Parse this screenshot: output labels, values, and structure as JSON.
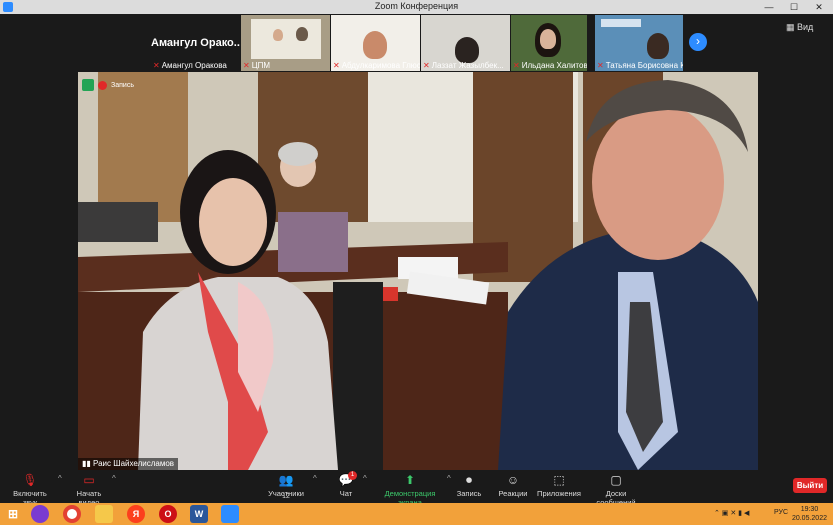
{
  "window": {
    "title": "Zoom Конференция",
    "minimize_glyph": "—",
    "maximize_glyph": "☐",
    "close_glyph": "✕"
  },
  "gallery": {
    "tiles": [
      {
        "name": "Амангул Оракова",
        "big_label": "Амангул  Орако..."
      },
      {
        "name": "ЦПМ"
      },
      {
        "name": "Абдулкаримова Глюся"
      },
      {
        "name": "Лаззат Жазылбек..."
      },
      {
        "name": "Ильдана Халитова"
      },
      {
        "name": "Татьяна Борисовна Ко..."
      }
    ],
    "next_glyph": "›",
    "view_label": "Вид",
    "view_icon": "grid-icon"
  },
  "main_video": {
    "recording_label": "Запись",
    "speaker_name": "Раис Шайхелисламов"
  },
  "toolbar": {
    "unmute_label": "Включить звук",
    "start_video_label": "Начать видео",
    "participants_label": "Участники",
    "participants_count": "12",
    "chat_label": "Чат",
    "chat_badge": "1",
    "share_label": "Демонстрация экрана",
    "record_label": "Запись",
    "reactions_label": "Реакции",
    "apps_label": "Приложения",
    "whiteboards_label": "Доски сообщений",
    "leave_label": "Выйти",
    "caret": "^"
  },
  "taskbar": {
    "language": "РУС",
    "time": "19:30",
    "date": "20.05.2022",
    "yandex_label": "Я",
    "word_label": "W",
    "opera_label": "O"
  },
  "colors": {
    "accent": "#2d8cff",
    "share_green": "#3cc86b",
    "leave_red": "#e02828",
    "taskbar": "#f2a13a"
  }
}
